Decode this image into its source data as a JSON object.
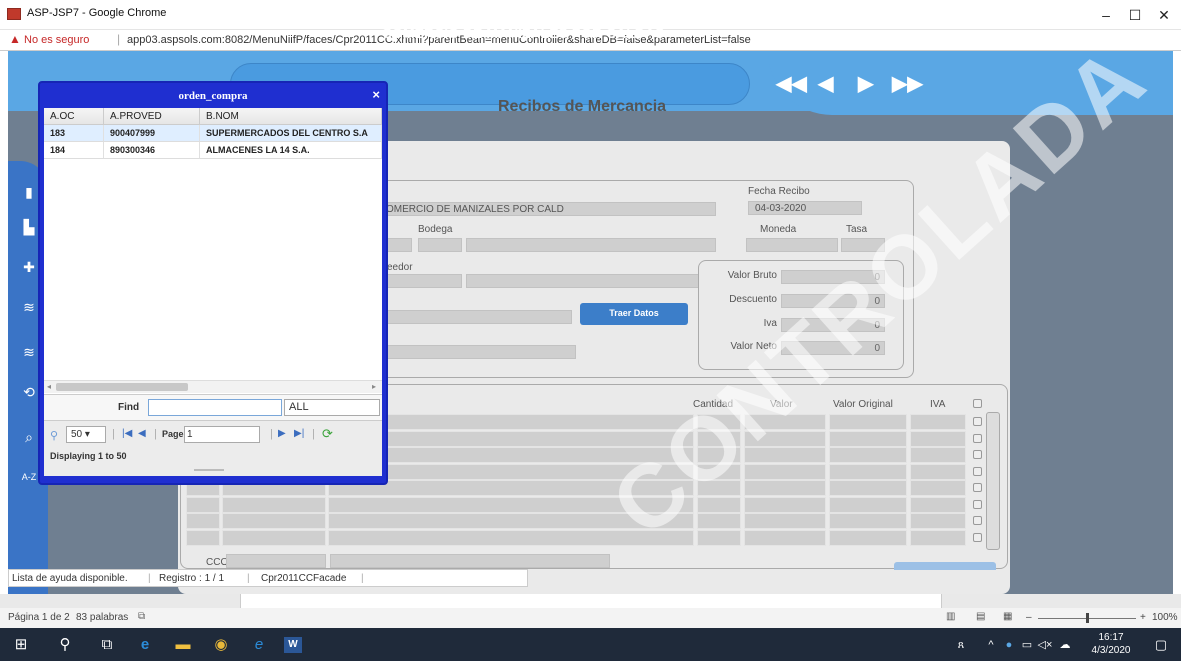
{
  "window": {
    "title": "ASP-JSP7 - Google Chrome",
    "minimize": "–",
    "maximize": "☐",
    "close": "✕"
  },
  "address": {
    "security": "No es seguro",
    "url": "app03.aspsols.com:8082/MenuNiifP/faces/Cpr2011CC.xhtml?parentBean=menuController&shareDB=false&parameterList=false"
  },
  "header": {
    "company": "COMERCIO DE MANIZALES POR CALDAS",
    "nav": [
      "◀◀",
      "◀",
      "▶",
      "▶▶"
    ]
  },
  "form": {
    "title": "Recibos de Mercancia",
    "company_value": "OMERCIO DE MANIZALES POR CALD",
    "bodega_label": "Bodega",
    "proveedor_label": "veedor",
    "fecha_label": "Fecha Recibo",
    "fecha_value": "04-03-2020",
    "moneda_label": "Moneda",
    "tasa_label": "Tasa",
    "totals": [
      {
        "label": "Valor Bruto",
        "value": "0"
      },
      {
        "label": "Descuento",
        "value": "0"
      },
      {
        "label": "Iva",
        "value": "0"
      },
      {
        "label": "Valor Neto",
        "value": "0"
      }
    ],
    "traer_button": "Traer Datos",
    "grid_headers": [
      "Cantidad",
      "Valor",
      "Valor Original",
      "IVA"
    ],
    "ccos_label": "CCOS"
  },
  "status": {
    "help": "Lista de ayuda disponible.",
    "registro": "Registro : 1 / 1",
    "facade": "Cpr2011CCFacade"
  },
  "popup": {
    "title": "orden_compra",
    "close": "×",
    "columns": [
      "A.OC",
      "A.PROVED",
      "B.NOM"
    ],
    "rows": [
      [
        "183",
        "900407999",
        "SUPERMERCADOS DEL CENTRO S.A"
      ],
      [
        "184",
        "890300346",
        "ALMACENES LA 14 S.A."
      ]
    ],
    "find_label": "Find",
    "find_value": "",
    "find_scope": "ALL",
    "page_size": "50",
    "page_label": "Page",
    "page_value": "1",
    "displaying": "Displaying 1 to 50"
  },
  "word": {
    "page": "Página 1 de 2",
    "words": "83 palabras",
    "zoom": "100%"
  },
  "taskbar": {
    "time": "16:17",
    "date": "4/3/2020"
  },
  "colors": {
    "popup_border": "#1f2fd0",
    "header_blue": "#5aa7e4",
    "button_blue": "#3c7ec9"
  }
}
